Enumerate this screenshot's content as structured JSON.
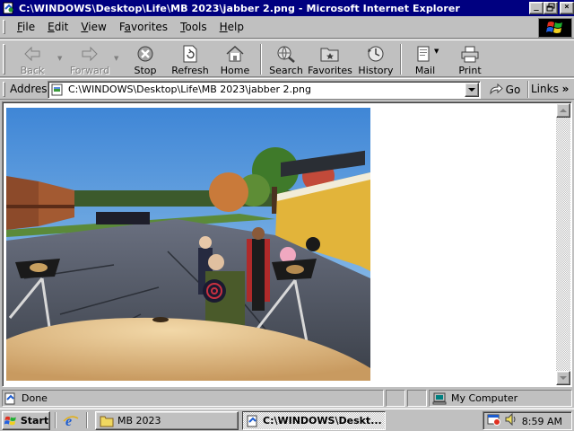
{
  "window": {
    "title": "C:\\WINDOWS\\Desktop\\Life\\MB 2023\\jabber 2.png - Microsoft Internet Explorer",
    "caption_buttons": {
      "minimize": "_",
      "maximize": "▫",
      "close": "×"
    }
  },
  "menubar": {
    "items": [
      {
        "hotkey": "F",
        "rest": "ile"
      },
      {
        "hotkey": "E",
        "rest": "dit"
      },
      {
        "hotkey": "V",
        "rest": "iew"
      },
      {
        "pre": "F",
        "hotkey": "a",
        "rest": "vorites"
      },
      {
        "hotkey": "T",
        "rest": "ools"
      },
      {
        "hotkey": "H",
        "rest": "elp"
      }
    ]
  },
  "toolbar": {
    "back": "Back",
    "forward": "Forward",
    "stop": "Stop",
    "refresh": "Refresh",
    "home": "Home",
    "search": "Search",
    "favorites": "Favorites",
    "history": "History",
    "mail": "Mail",
    "print": "Print"
  },
  "addressbar": {
    "label": "Address",
    "value": "C:\\WINDOWS\\Desktop\\Life\\MB 2023\\jabber 2.png",
    "go": "Go",
    "links": "Links"
  },
  "statusbar": {
    "status": "Done",
    "zone": "My Computer"
  },
  "taskbar": {
    "start": "Start",
    "tasks": [
      {
        "label": "MB 2023",
        "active": false
      },
      {
        "label": "C:\\WINDOWS\\Deskt...",
        "active": true
      }
    ],
    "clock": "8:59 AM"
  },
  "icons": {
    "app": "ie-page-icon",
    "throbber": "windows-logo-icon",
    "back": "back-arrow-icon",
    "forward": "forward-arrow-icon",
    "stop": "stop-icon",
    "refresh": "refresh-icon",
    "home": "home-icon",
    "search": "search-globe-icon",
    "favorites": "favorites-folder-icon",
    "history": "history-icon",
    "mail": "mail-icon",
    "print": "printer-icon",
    "computer": "my-computer-icon",
    "folder": "folder-icon",
    "speaker": "speaker-icon",
    "scheduler": "scheduler-icon"
  },
  "colors": {
    "titlebar": "#000080",
    "face": "#c0c0c0",
    "ie_blue": "#1c5cd0"
  }
}
